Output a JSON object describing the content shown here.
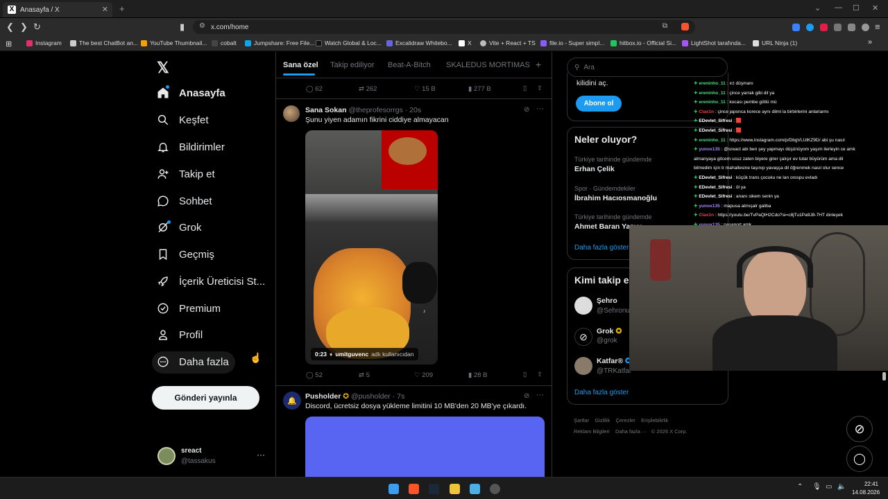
{
  "browser": {
    "tab_title": "Anasayfa / X",
    "url": "x.com/home",
    "bookmarks": [
      "Instagram",
      "The best ChatBot an...",
      "YouTube Thumbnail...",
      "cobalt",
      "Jumpshare: Free File...",
      "Watch Global & Loc...",
      "Excalidraw Whitebo...",
      "X",
      "Vite + React + TS",
      "file.io - Super simpl...",
      "hitbox.io - Official Si...",
      "LightShot tarafında...",
      "URL Ninja (1)"
    ]
  },
  "sidebar": {
    "items": [
      {
        "label": "Anasayfa",
        "icon": "home-icon"
      },
      {
        "label": "Keşfet",
        "icon": "search-icon"
      },
      {
        "label": "Bildirimler",
        "icon": "bell-icon"
      },
      {
        "label": "Takip et",
        "icon": "follow-icon"
      },
      {
        "label": "Sohbet",
        "icon": "chat-icon"
      },
      {
        "label": "Grok",
        "icon": "grok-icon"
      },
      {
        "label": "Geçmiş",
        "icon": "bookmark-icon"
      },
      {
        "label": "İçerik Üreticisi St...",
        "icon": "rocket-icon"
      },
      {
        "label": "Premium",
        "icon": "verified-icon"
      },
      {
        "label": "Profil",
        "icon": "person-icon"
      },
      {
        "label": "Daha fazla",
        "icon": "more-circle-icon"
      }
    ],
    "compose_label": "Gönderi yayınla",
    "account": {
      "name": "sreact",
      "handle": "@tassakus"
    }
  },
  "feed": {
    "tabs": [
      "Sana özel",
      "Takip ediliyor",
      "Beat-A-Bitch",
      "SKALEDUS MORTIMAS"
    ],
    "top_stats": {
      "replies": "62",
      "reposts": "262",
      "likes": "15 B",
      "views": "277 B"
    },
    "post1": {
      "name": "Sana Sokan",
      "handle": "@theprofesorrgs",
      "time": "· 20s",
      "text": "Şunu yiyen adamın fikrini ciddiye almayacan",
      "video_time": "0:23",
      "video_credit_user": "umitguvenc",
      "video_credit_suffix": "adlı kullanıcıdan",
      "stats": {
        "replies": "52",
        "reposts": "5",
        "likes": "209",
        "views": "28 B"
      }
    },
    "post2": {
      "name": "Pusholder",
      "handle": "@pusholder",
      "time": "· 7s",
      "text": "Discord, ücretsiz dosya yükleme limitini 10 MB'den 20 MB'ye çıkardı."
    }
  },
  "right": {
    "search_placeholder": "Ara",
    "premium_tail": "kilidini aç.",
    "subscribe_label": "Abone ol",
    "trends_title": "Neler oluyor?",
    "trends": [
      {
        "sub": "Türkiye tarihinde gündemde",
        "title": "Erhan Çelik"
      },
      {
        "sub": "Spor · Gündemdekiler",
        "title": "İbrahim Hacıosmanoğlu"
      },
      {
        "sub": "Türkiye tarihinde gündemde",
        "title": "Ahmet Baran Yazıcı"
      }
    ],
    "trends_more": "Daha fazla göster",
    "wtf_title": "Kimi takip e",
    "wtf": [
      {
        "name": "Şehro",
        "handle": "@Sehronu"
      },
      {
        "name": "Grok",
        "handle": "@grok"
      },
      {
        "name": "Katfar®",
        "handle": "@TRKatfar"
      }
    ],
    "wtf_more": "Daha fazla göster",
    "footer": [
      "Şartlar",
      "Gizlilik",
      "Çerezler",
      "Erişilebilirlik",
      "Reklam Bilgileri",
      "Daha fazla ···",
      "© 2026 X Corp."
    ]
  },
  "chat": [
    {
      "user": "ereninho_11",
      "cls": "u1",
      "msg": " : ırz düşmanı"
    },
    {
      "user": "ereninho_11",
      "cls": "u1",
      "msg": " : çince yarrak gibi dil ya"
    },
    {
      "user": "ereninho_11",
      "cls": "u1",
      "msg": " : kocası pembe götlü mü"
    },
    {
      "user": "Clax1n",
      "cls": "u2",
      "msg": " : çince japonca korece aynı dilmi la birbirlerini anlarlarmı"
    },
    {
      "user": "EDevlet_Sifresi",
      "cls": "u3",
      "msg": " : 🟥"
    },
    {
      "user": "EDevlet_Sifresi",
      "cls": "u3",
      "msg": " : 🟥"
    },
    {
      "user": "ereninho_11",
      "cls": "u1",
      "msg": " : https://www.instagram.com/p/DbgVLUlKZ9D/ abi şu nasıl"
    },
    {
      "user": "yunox135",
      "cls": "u4",
      "msg": " : @sreact abi ben şey yapmayı düşünüyom yaşım ilerleyin ce amk"
    },
    {
      "user": "",
      "cls": "u3",
      "msg": "almanyaya gitcem ucuz zaten biyere girer çalışır ev tutar büyürüm ama dil"
    },
    {
      "user": "",
      "cls": "u3",
      "msg": "bilmedim için tr mahallesine taşınıp yavaşça dil öğrenmek nasıl olur sence"
    },
    {
      "user": "EDevlet_Sifresi",
      "cls": "u3",
      "msg": " : küçük trans çocuku ne lan orospu evladı"
    },
    {
      "user": "EDevlet_Sifresi",
      "cls": "u3",
      "msg": " : öl ya"
    },
    {
      "user": "EDevlet_Sifresi",
      "cls": "u3",
      "msg": " : ananı sikem senin ya"
    },
    {
      "user": "yunox135",
      "cls": "u4",
      "msg": " : mapusa atmışalr galiba"
    },
    {
      "user": "Clax1n",
      "cls": "u2",
      "msg": " : https://youtu.be/TvPaQlH2Cdo?si=c8jTu1Pa9J8-7HT dinleyek"
    },
    {
      "user": "yunox135",
      "cls": "u4",
      "msg": " : pasaport amk"
    }
  ],
  "taskbar": {
    "time": "22:41",
    "date": "14.08.2026"
  }
}
